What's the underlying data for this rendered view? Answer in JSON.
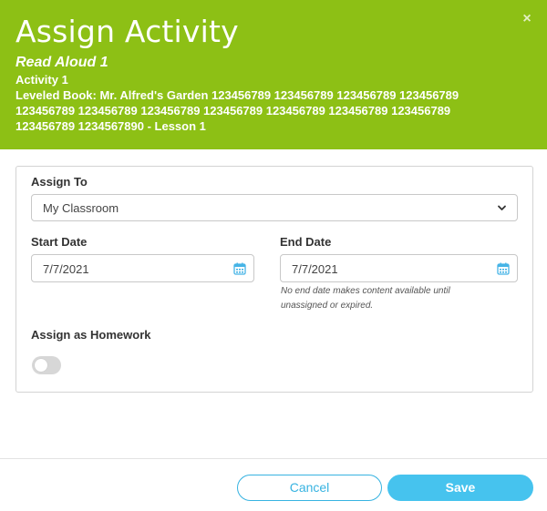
{
  "header": {
    "title": "Assign Activity",
    "subtitle": "Read Aloud 1",
    "activity": "Activity 1",
    "book_line_1": "Leveled Book: Mr. Alfred's Garden 123456789 123456789 123456789 123456789",
    "book_line_2": "123456789 123456789 123456789 123456789 123456789 123456789 123456789",
    "book_line_3": "123456789 1234567890 - Lesson 1",
    "close_glyph": "×",
    "background_color": "#8dc015"
  },
  "form": {
    "assign_to_label": "Assign To",
    "assign_to_value": "My Classroom",
    "start_date_label": "Start Date",
    "start_date_value": "7/7/2021",
    "end_date_label": "End Date",
    "end_date_value": "7/7/2021",
    "end_date_hint_line_1": "No end date makes content available until",
    "end_date_hint_line_2": "unassigned or expired.",
    "homework_label": "Assign as Homework",
    "homework_enabled": false
  },
  "footer": {
    "cancel_label": "Cancel",
    "save_label": "Save",
    "accent_color": "#46c3ee"
  },
  "icons": {
    "close": "close-icon",
    "select": "chevron-down-icon",
    "calendar": "calendar-icon"
  }
}
